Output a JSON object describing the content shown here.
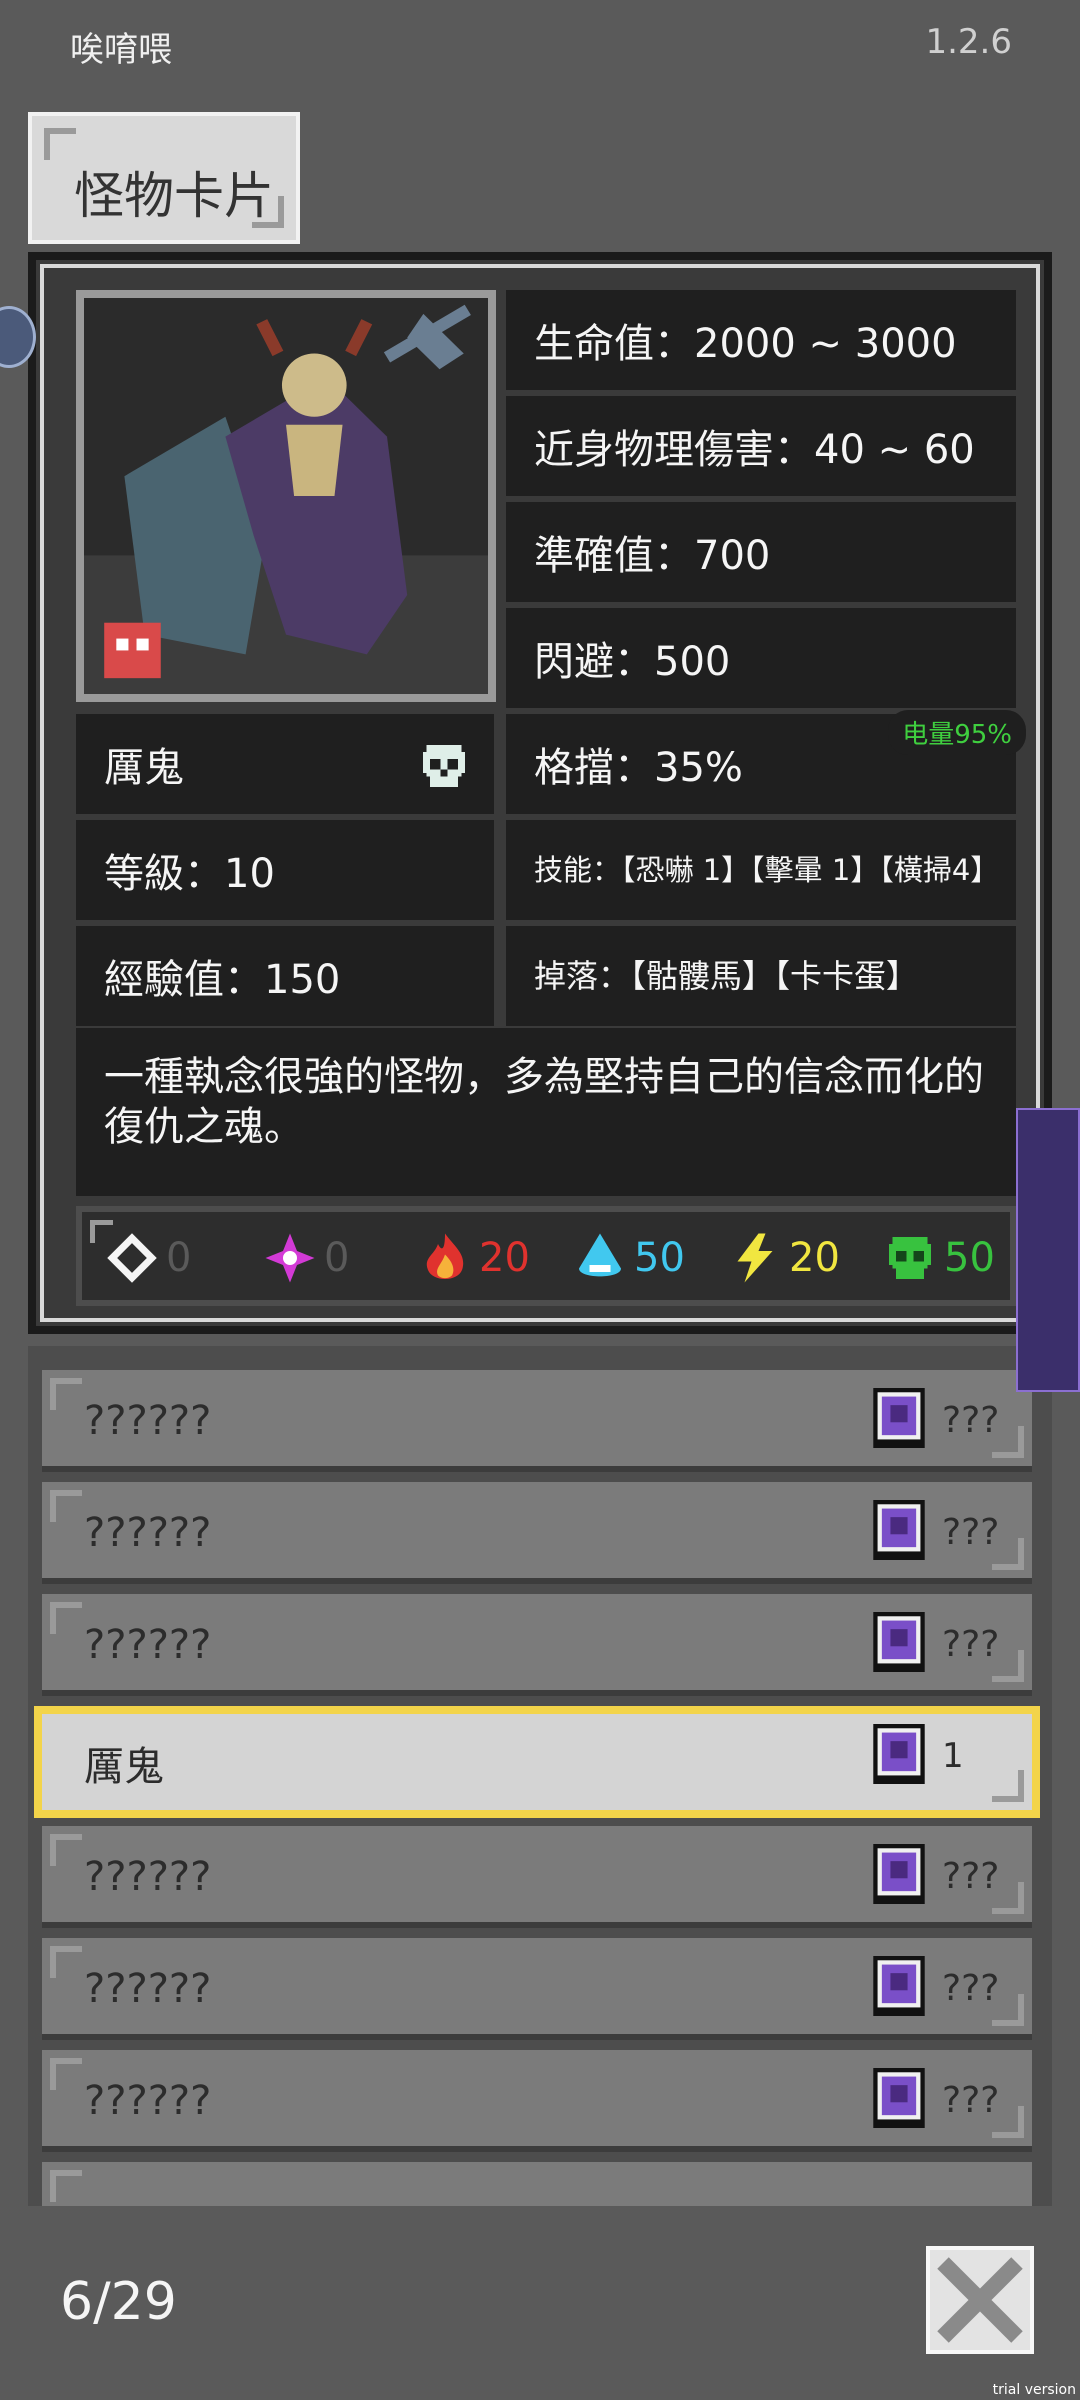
{
  "header": {
    "title": "唉唷喂",
    "version": "1.2.6"
  },
  "tab": {
    "label": "怪物卡片"
  },
  "monster": {
    "hp": "生命值：2000 ~ 3000",
    "melee": "近身物理傷害：40 ~ 60",
    "accuracy": "準確值：700",
    "evasion": "閃避：500",
    "block": "格擋：35%",
    "name": "厲鬼",
    "level": "等級：10",
    "skills": "技能：【恐嚇 1】【擊暈 1】【橫掃4】",
    "exp": "經驗值：150",
    "drops": "掉落：【骷髏馬】【卡卡蛋】",
    "description": "一種執念很強的怪物，多為堅持自己的信念而化的復仇之魂。"
  },
  "battery": "电量95%",
  "resistances": [
    {
      "icon": "physical-icon",
      "value": "0",
      "color": "#5a5a5a"
    },
    {
      "icon": "magic-icon",
      "value": "0",
      "color": "#5a5a5a"
    },
    {
      "icon": "fire-icon",
      "value": "20",
      "color": "#e0322e"
    },
    {
      "icon": "water-icon",
      "value": "50",
      "color": "#41c8ef"
    },
    {
      "icon": "lightning-icon",
      "value": "20",
      "color": "#f1e640"
    },
    {
      "icon": "poison-icon",
      "value": "50",
      "color": "#38c23f"
    }
  ],
  "list": {
    "rows": [
      {
        "name": "??????",
        "count": "???"
      },
      {
        "name": "??????",
        "count": "???"
      },
      {
        "name": "??????",
        "count": "???"
      },
      {
        "name": "厲鬼",
        "count": "1"
      },
      {
        "name": "??????",
        "count": "???"
      },
      {
        "name": "??????",
        "count": "???"
      },
      {
        "name": "??????",
        "count": "???"
      }
    ]
  },
  "pager": "6/29",
  "watermark": "trial version"
}
